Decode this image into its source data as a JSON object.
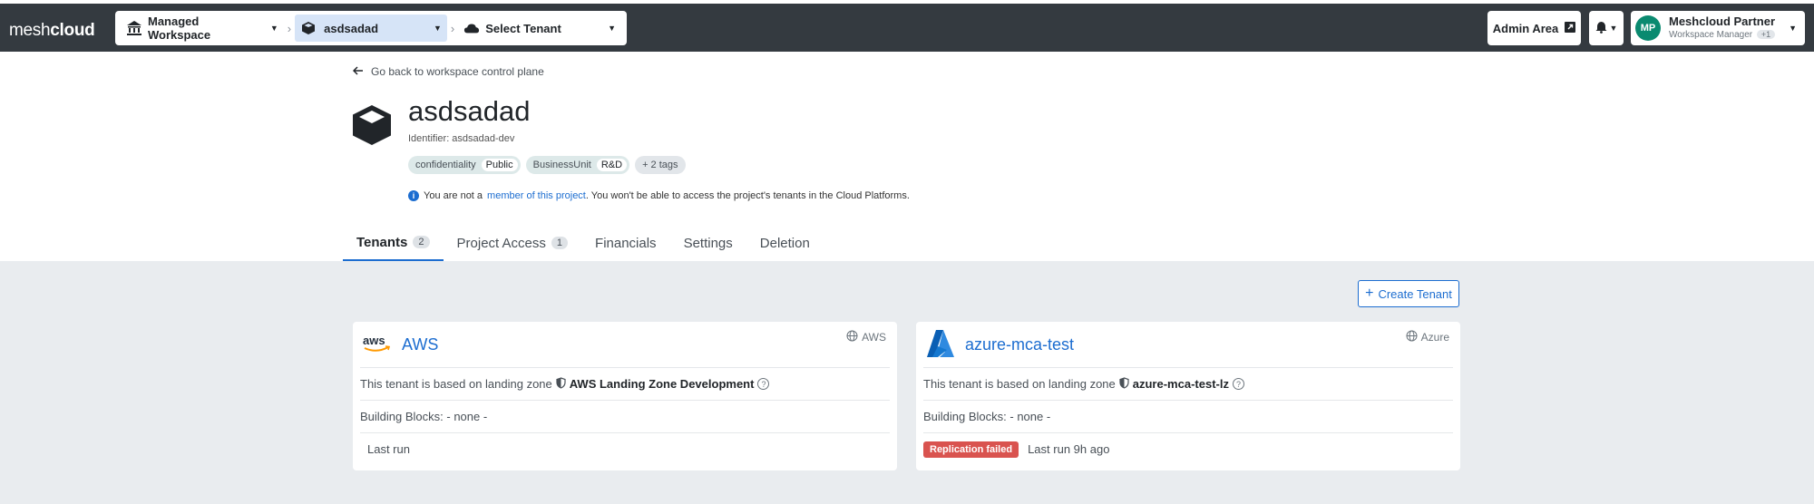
{
  "topbar": {
    "logo_light": "mesh",
    "logo_bold": "cloud",
    "workspace_label": "Managed Workspace",
    "project_label": "asdsadad",
    "tenant_label": "Select Tenant",
    "admin_label": "Admin Area",
    "user_initials": "MP",
    "user_name": "Meshcloud Partner",
    "user_role": "Workspace Manager",
    "user_role_count": "+1"
  },
  "header": {
    "back_link": "Go back to workspace control plane",
    "title": "asdsadad",
    "identifier": "Identifier: asdsadad-dev",
    "tags": [
      {
        "key": "confidentiality",
        "value": "Public"
      },
      {
        "key": "BusinessUnit",
        "value": "R&D"
      }
    ],
    "more_tags": "+ 2 tags",
    "info_prefix": "You are not a",
    "info_link": "member of this project",
    "info_suffix": ". You won't be able to access the project's tenants in the Cloud Platforms."
  },
  "tabs": [
    {
      "label": "Tenants",
      "count": "2"
    },
    {
      "label": "Project Access",
      "count": "1"
    },
    {
      "label": "Financials"
    },
    {
      "label": "Settings"
    },
    {
      "label": "Deletion"
    }
  ],
  "content": {
    "create_button": "Create Tenant",
    "tenants": [
      {
        "name": "AWS",
        "platform": "AWS",
        "lz_prefix": "This tenant is based on landing zone",
        "landing_zone": "AWS Landing Zone Development",
        "building_blocks": "Building Blocks: - none -",
        "status": "",
        "last_run": "Last run"
      },
      {
        "name": "azure-mca-test",
        "platform": "Azure",
        "lz_prefix": "This tenant is based on landing zone",
        "landing_zone": "azure-mca-test-lz",
        "building_blocks": "Building Blocks: - none -",
        "status": "Replication failed",
        "last_run": "Last run 9h ago"
      }
    ]
  },
  "colors": {
    "topbar": "#343a40",
    "accent": "#1c6dd0",
    "danger": "#d9534f",
    "avatar": "#0a8a70"
  }
}
